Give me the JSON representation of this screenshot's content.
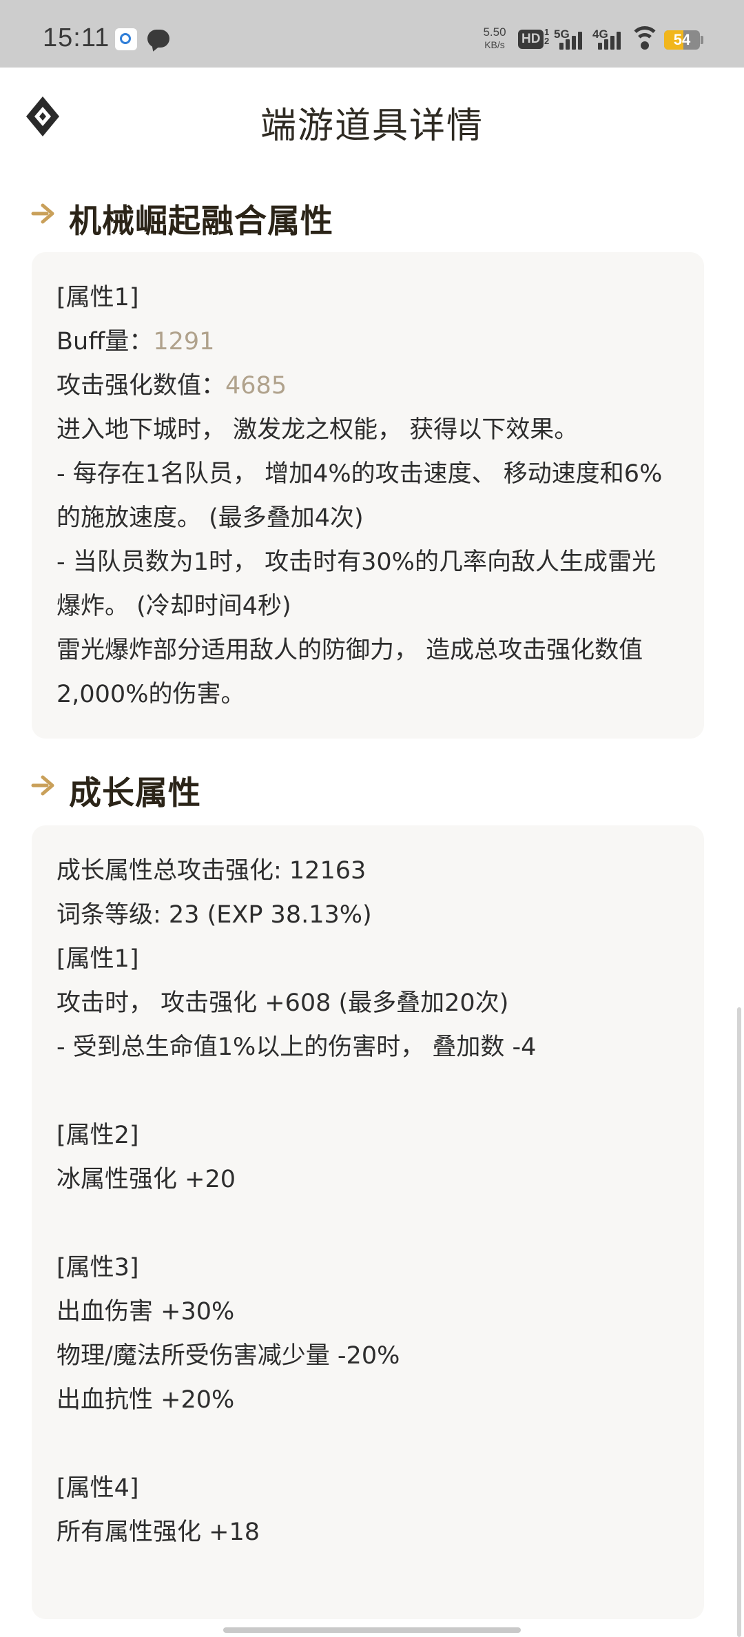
{
  "status_bar": {
    "time": "15:11",
    "notification_icons": [
      "qq-icon",
      "chat-bubble-icon"
    ],
    "net_speed": "5.50",
    "net_speed_unit": "KB/s",
    "hd_label": "HD",
    "hd_sims": "1 2",
    "sim1_label": "5G",
    "sim2_label": "4G",
    "battery": "54",
    "battery_level": 0.54,
    "colors": {
      "background": "#cdcdcd",
      "battery": "#f1b61c"
    }
  },
  "header": {
    "title": "端游道具详情",
    "back_icon": "diamond-logo-icon"
  },
  "colors": {
    "accent_gold": "#c9a05a",
    "value_text": "#b0a28c",
    "card_bg": "#f8f7f5",
    "section_title": "#2b2418"
  },
  "sections": [
    {
      "title": "机械崛起融合属性",
      "lines": [
        {
          "text": "[属性1]"
        },
        {
          "label": "Buff量：",
          "value": "1291"
        },
        {
          "label": "攻击强化数值：",
          "value": "4685"
        },
        {
          "text": "进入地下城时， 激发龙之权能， 获得以下效果。"
        },
        {
          "text": "- 每存在1名队员， 增加4%的攻击速度、 移动速度和6%"
        },
        {
          "text": "的施放速度。 (最多叠加4次)"
        },
        {
          "text": "- 当队员数为1时， 攻击时有30%的几率向敌人生成雷光"
        },
        {
          "text": "爆炸。 (冷却时间4秒)"
        },
        {
          "text": "雷光爆炸部分适用敌人的防御力， 造成总攻击强化数值"
        },
        {
          "text": "2,000%的伤害。"
        }
      ]
    },
    {
      "title": "成长属性",
      "lines": [
        {
          "text": "成长属性总攻击强化: 12163"
        },
        {
          "text": "词条等级: 23 (EXP 38.13%)"
        },
        {
          "text": "[属性1]"
        },
        {
          "text": "攻击时， 攻击强化 +608 (最多叠加20次)"
        },
        {
          "text": "- 受到总生命值1%以上的伤害时， 叠加数 -4"
        },
        {
          "text": ""
        },
        {
          "text": "[属性2]"
        },
        {
          "text": "冰属性强化 +20"
        },
        {
          "text": ""
        },
        {
          "text": "[属性3]"
        },
        {
          "text": "出血伤害 +30%"
        },
        {
          "text": "物理/魔法所受伤害减少量 -20%"
        },
        {
          "text": "出血抗性 +20%"
        },
        {
          "text": ""
        },
        {
          "text": "[属性4]"
        },
        {
          "text": "所有属性强化 +18"
        }
      ]
    }
  ]
}
